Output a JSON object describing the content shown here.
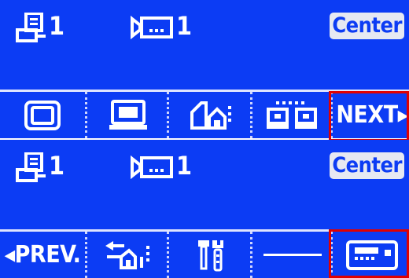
{
  "screens": [
    {
      "status": {
        "monitor_count": "1",
        "camera_count": "1",
        "mode_badge": "Center"
      },
      "softkeys": [
        {
          "icon": "monitor-icon"
        },
        {
          "icon": "keyboard-icon"
        },
        {
          "icon": "tour-icon"
        },
        {
          "icon": "group-icon"
        },
        {
          "label": "NEXT▸",
          "icon": "next-arrow-icon"
        }
      ]
    },
    {
      "status": {
        "monitor_count": "1",
        "camera_count": "1",
        "mode_badge": "Center"
      },
      "softkeys": [
        {
          "label": "◂PREV.",
          "icon": "prev-arrow-icon"
        },
        {
          "icon": "sequence-icon"
        },
        {
          "icon": "tools-icon"
        },
        {
          "label": "—"
        },
        {
          "icon": "dvr-icon"
        }
      ]
    }
  ],
  "colors": {
    "screen_bg": "#0c3cf4",
    "foreground": "#ffffff",
    "highlight": "#e00000"
  }
}
